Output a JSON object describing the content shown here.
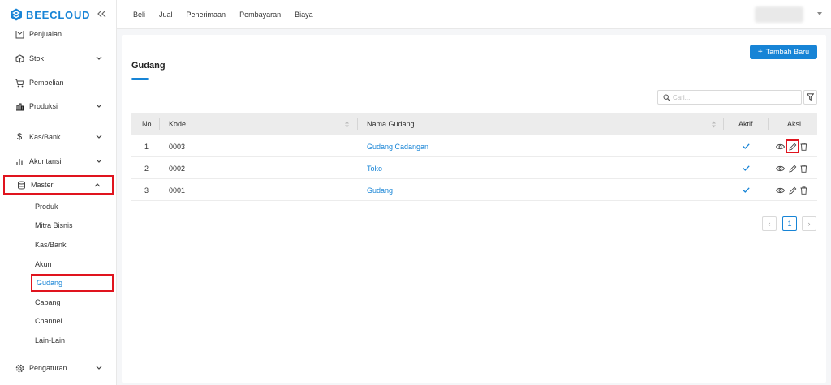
{
  "brand": {
    "name": "BEECLOUD"
  },
  "sidebar": {
    "items": [
      {
        "label": "Penjualan",
        "icon": "receipt-icon"
      },
      {
        "label": "Stok",
        "icon": "box-icon"
      },
      {
        "label": "Pembelian",
        "icon": "cart-icon"
      },
      {
        "label": "Produksi",
        "icon": "factory-icon"
      },
      {
        "label": "Kas/Bank",
        "icon": "dollar-icon"
      },
      {
        "label": "Akuntansi",
        "icon": "bar-chart-icon"
      },
      {
        "label": "Master",
        "icon": "database-icon"
      },
      {
        "label": "Pengaturan",
        "icon": "gear-icon"
      }
    ],
    "master_sub": [
      "Produk",
      "Mitra Bisnis",
      "Kas/Bank",
      "Akun",
      "Gudang",
      "Cabang",
      "Channel",
      "Lain-Lain"
    ],
    "active_sub": "Gudang"
  },
  "topnav": [
    "Beli",
    "Jual",
    "Penerimaan",
    "Pembayaran",
    "Biaya"
  ],
  "page": {
    "title": "Gudang",
    "add_button": "Tambah Baru",
    "search_placeholder": "Cari..."
  },
  "table": {
    "headers": {
      "no": "No",
      "kode": "Kode",
      "nama": "Nama Gudang",
      "aktif": "Aktif",
      "aksi": "Aksi"
    },
    "rows": [
      {
        "no": "1",
        "kode": "0003",
        "nama": "Gudang Cadangan",
        "aktif": true
      },
      {
        "no": "2",
        "kode": "0002",
        "nama": "Toko",
        "aktif": true
      },
      {
        "no": "3",
        "kode": "0001",
        "nama": "Gudang",
        "aktif": true
      }
    ]
  },
  "pagination": {
    "current": "1",
    "prev": "‹",
    "next": "›"
  },
  "colors": {
    "accent": "#1784d6",
    "highlight": "#e0141e"
  }
}
